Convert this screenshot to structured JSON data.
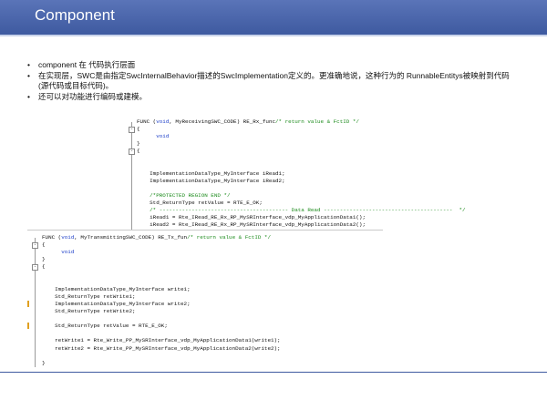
{
  "slide": {
    "title": "Component",
    "bullets": [
      "component 在 代码执行层面",
      "在实现层，SWC是由指定SwcInternalBehavior描述的SwcImplementation定义的。更准确地说，这种行为的 RunnableEntitys被映射到代码(源代码或目标代码)。",
      "还可以对功能进行编码或建模。"
    ]
  },
  "code_top": {
    "lines": [
      {
        "segments": [
          {
            "t": "FUNC (",
            "c": ""
          },
          {
            "t": "void",
            "c": "kw"
          },
          {
            "t": ", MyReceivingSWC_CODE) RE_Rx_func",
            "c": ""
          },
          {
            "t": "/* return value & FctID */",
            "c": "cm"
          }
        ]
      },
      {
        "segments": [
          {
            "t": "{",
            "c": ""
          }
        ]
      },
      {
        "segments": [
          {
            "t": "      ",
            "c": ""
          },
          {
            "t": "void",
            "c": "kw"
          }
        ]
      },
      {
        "segments": [
          {
            "t": "}",
            "c": ""
          }
        ]
      },
      {
        "segments": [
          {
            "t": "{",
            "c": ""
          }
        ]
      },
      {
        "segments": [
          {
            "t": "",
            "c": ""
          }
        ]
      },
      {
        "segments": [
          {
            "t": "",
            "c": ""
          }
        ]
      },
      {
        "segments": [
          {
            "t": "    ImplementationDataType_MyInterface iRead1;",
            "c": ""
          }
        ]
      },
      {
        "segments": [
          {
            "t": "    ImplementationDataType_MyInterface iRead2;",
            "c": ""
          }
        ]
      },
      {
        "segments": [
          {
            "t": "",
            "c": ""
          }
        ]
      },
      {
        "segments": [
          {
            "t": "    ",
            "c": ""
          },
          {
            "t": "/*PROTECTED REGION END */",
            "c": "cm"
          }
        ]
      },
      {
        "segments": [
          {
            "t": "    Std_ReturnType retValue = RTE_E_OK;",
            "c": ""
          }
        ]
      },
      {
        "segments": [
          {
            "t": "    ",
            "c": ""
          },
          {
            "t": "/* ---------------------------------------- Data Read ----------------------------------------  */",
            "c": "cm"
          }
        ]
      },
      {
        "segments": [
          {
            "t": "    iRead1 = Rte_IRead_RE_Rx_RP_MySRInterface_vdp_MyApplicationData1();",
            "c": ""
          }
        ]
      },
      {
        "segments": [
          {
            "t": "    iRead2 = Rte_IRead_RE_Rx_RP_MySRInterface_vdp_MyApplicationData2();",
            "c": ""
          }
        ]
      }
    ]
  },
  "code_bottom": {
    "lines": [
      {
        "segments": [
          {
            "t": "FUNC (",
            "c": ""
          },
          {
            "t": "void",
            "c": "kw"
          },
          {
            "t": ", MyTransmittingSWC_CODE) RE_Tx_fun",
            "c": ""
          },
          {
            "t": "/* return value & FctID */",
            "c": "cm"
          }
        ]
      },
      {
        "segments": [
          {
            "t": "{",
            "c": ""
          }
        ]
      },
      {
        "segments": [
          {
            "t": "      ",
            "c": ""
          },
          {
            "t": "void",
            "c": "kw"
          }
        ]
      },
      {
        "segments": [
          {
            "t": "}",
            "c": ""
          }
        ]
      },
      {
        "segments": [
          {
            "t": "{",
            "c": ""
          }
        ]
      },
      {
        "segments": [
          {
            "t": "",
            "c": ""
          }
        ]
      },
      {
        "segments": [
          {
            "t": "",
            "c": ""
          }
        ]
      },
      {
        "segments": [
          {
            "t": "    ImplementationDataType_MyInterface write1;",
            "c": ""
          }
        ]
      },
      {
        "segments": [
          {
            "t": "    Std_ReturnType retWrite1;",
            "c": ""
          }
        ]
      },
      {
        "segments": [
          {
            "t": "    ImplementationDataType_MyInterface write2;",
            "c": ""
          }
        ]
      },
      {
        "segments": [
          {
            "t": "    Std_ReturnType retWrite2;",
            "c": ""
          }
        ]
      },
      {
        "segments": [
          {
            "t": "",
            "c": ""
          }
        ]
      },
      {
        "segments": [
          {
            "t": "    Std_ReturnType retValue = RTE_E_OK;",
            "c": ""
          }
        ]
      },
      {
        "segments": [
          {
            "t": "",
            "c": ""
          }
        ]
      },
      {
        "segments": [
          {
            "t": "    retWrite1 = Rte_Write_PP_MySRInterface_vdp_MyApplicationData1(write1);",
            "c": ""
          }
        ]
      },
      {
        "segments": [
          {
            "t": "    retWrite2 = Rte_Write_PP_MySRInterface_vdp_MyApplicationData2(write2);",
            "c": ""
          }
        ]
      },
      {
        "segments": [
          {
            "t": "",
            "c": ""
          }
        ]
      },
      {
        "segments": [
          {
            "t": "}",
            "c": ""
          }
        ]
      }
    ]
  },
  "colors": {
    "title_bar": "#3e5aa0",
    "keyword": "#1a3cc8",
    "comment": "#1a8a1a",
    "change_marker": "#e0a020"
  }
}
